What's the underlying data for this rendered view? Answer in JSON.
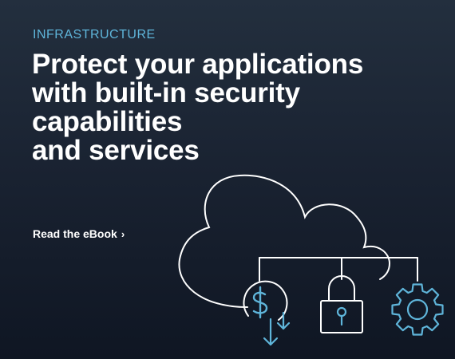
{
  "eyebrow": "INFRASTRUCTURE",
  "headline": {
    "line1": "Protect your applications",
    "line2": "with built-in security",
    "line3": "capabilities",
    "line4": "and services"
  },
  "cta": {
    "label": "Read the eBook",
    "chevron": "›"
  },
  "icons": [
    "cloud-icon",
    "dollar-download-icon",
    "lock-icon",
    "gear-icon"
  ],
  "colors": {
    "background_top": "#232f3e",
    "background_bottom": "#0f1623",
    "accent_blue": "#5fb5da",
    "line_white": "#ffffff",
    "text_white": "#ffffff"
  }
}
